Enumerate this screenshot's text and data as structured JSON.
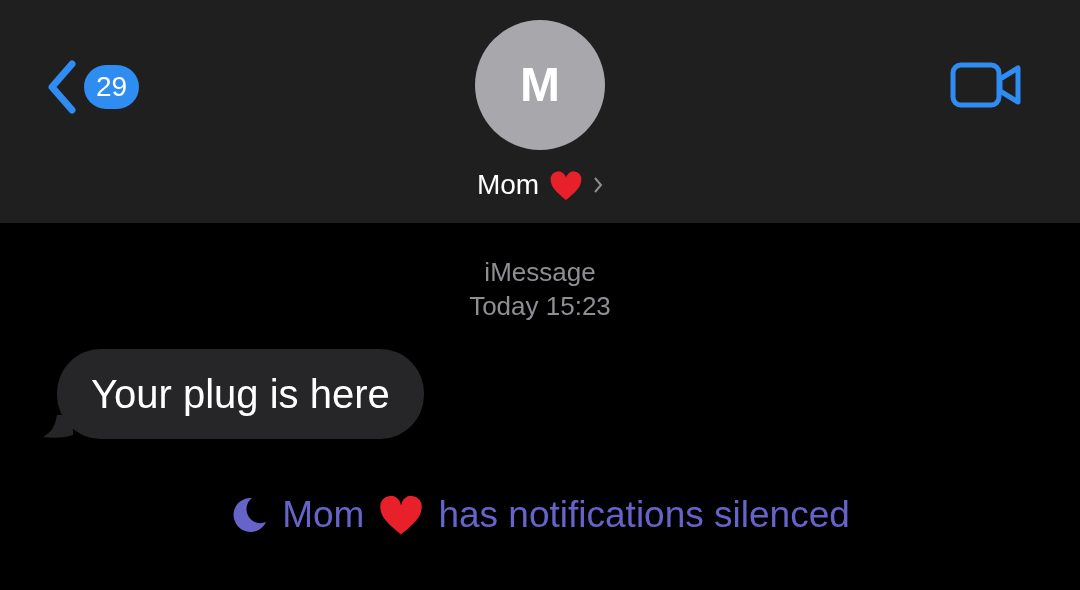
{
  "header": {
    "back_badge": "29",
    "avatar_initial": "M",
    "contact_name": "Mom"
  },
  "thread": {
    "service": "iMessage",
    "timestamp_day": "Today",
    "timestamp_time": "15:23"
  },
  "messages": [
    {
      "text": "Your plug is here",
      "kind": "incoming"
    }
  ],
  "notice": {
    "name": "Mom",
    "text": "has notifications silenced"
  }
}
